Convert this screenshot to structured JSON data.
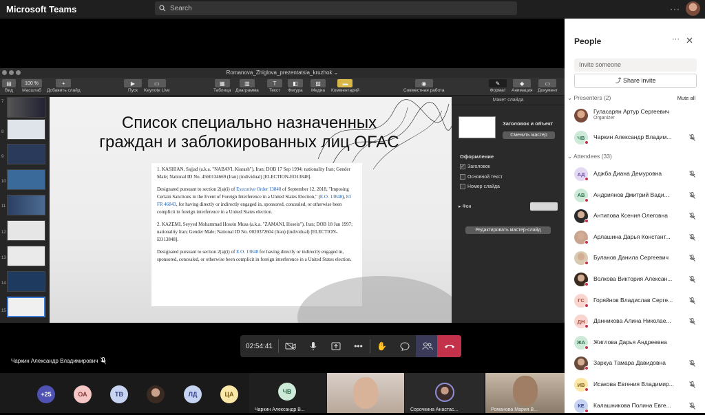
{
  "app": {
    "title": "Microsoft Teams",
    "search_placeholder": "Search",
    "more": "···"
  },
  "keynote": {
    "file_title": "Romanova_Zhiglova_prezentatsia_kruzhok ⌄",
    "zoom": "100 %",
    "toolbar": [
      "Вид",
      "Масштаб",
      "Добавить слайд",
      "Пуск",
      "Keynote Live",
      "Таблица",
      "Диаграмма",
      "Текст",
      "Фигура",
      "Медиа",
      "Комментарий",
      "Совместная работа",
      "Формат",
      "Анимация",
      "Документ"
    ],
    "thumb_numbers": [
      "7",
      "8",
      "9",
      "10",
      "11",
      "12",
      "13",
      "14",
      "15"
    ],
    "slide_title_line1": "Список специально назначенных",
    "slide_title_line2": "граждан и заблокированных лиц OFAC",
    "textbox": {
      "p1": "1. KASHIAN, Sajjad (a.k.a. \"NABAVI, Kiarash\"), Iran; DOB 17 Sep 1994; nationality Iran; Gender Male; National ID No. 4560134669 (Iran) (individual) [ELECTION-EO13848].",
      "p2a": "Designated pursuant to section 2(a)(i) of ",
      "p2link1": "Executive Order 13848",
      "p2b": " of September 12, 2018, \"Imposing Certain Sanctions in the Event of Foreign Interference in a United States Election,\" (",
      "p2link2": "E.O. 13848",
      "p2c": "), ",
      "p2link3": "83 FR 46843",
      "p2d": ", for having directly or indirectly engaged in, sponsored, concealed, or otherwise been complicit in foreign interference in a United States election.",
      "p3": "2. KAZEMI, Seyyed Mohammad Hosein Musa (a.k.a. \"ZAMANI, Hosein\"), Iran; DOB 18 Jun 1997; nationality Iran; Gender Male; National ID No. 0020372604 (Iran) (individual) [ELECTION-EO13848].",
      "p4a": "Designated pursuant to section 2(a)(i) of ",
      "p4link": "E.O. 13848",
      "p4b": " for having directly or indirectly engaged in, sponsored, concealed, or otherwise been complicit in foreign interference in a United States election."
    },
    "inspector": {
      "header": "Макет слайда",
      "layout_name": "Заголовок и объект",
      "change_master": "Сменить мастер",
      "design": "Оформление",
      "chk_title": "Заголовок",
      "chk_body": "Основной текст",
      "chk_number": "Номер слайда",
      "background": "Фон",
      "edit_master": "Редактировать мастер-слайд"
    }
  },
  "call": {
    "timer": "02:54:41",
    "speaker": "Чаркин Александр Владимирович"
  },
  "gallery": [
    {
      "initials": "+25",
      "color": "#4f52b2"
    },
    {
      "initials": "ОА",
      "color": "#f4c6c6"
    },
    {
      "initials": "ТВ",
      "color": "#c7d4f1"
    },
    {
      "initials": "",
      "color": "#5a4a3a"
    },
    {
      "initials": "ЛД",
      "color": "#c7d4f1"
    },
    {
      "initials": "ЦА",
      "color": "#fbe7a8"
    },
    {
      "initials": "ЧВ",
      "color": "#cde9d8",
      "label": "Чаркин Александр В..."
    },
    {
      "label": "Сорочкина Анастас..."
    },
    {
      "label": "Романова Мария В..."
    }
  ],
  "people": {
    "title": "People",
    "invite_placeholder": "Invite someone",
    "share_invite": "Share invite",
    "presenters_label": "Presenters (2)",
    "mute_all": "Mute all",
    "presenters": [
      {
        "name": "Гуласарян Артур Сергеевич",
        "role": "Organizer",
        "initials": "",
        "color": "#b07a5a"
      },
      {
        "name": "Чаркин Александр Владим...",
        "initials": "ЧВ",
        "color": "#cde9d8"
      }
    ],
    "attendees_label": "Attendees (33)",
    "attendees": [
      {
        "name": "Аджба Диана Демуровна",
        "initials": "АД",
        "color": "#e3d9f3"
      },
      {
        "name": "Андриянов Дмитрий Вади...",
        "initials": "АВ",
        "color": "#cde9d8"
      },
      {
        "name": "Антипова Ксения Олеговна",
        "initials": "",
        "color": "#2b2b2b"
      },
      {
        "name": "Арлашина Дарья Констант...",
        "initials": "",
        "color": "#c9a48e"
      },
      {
        "name": "Буланов Данила Сергеевич",
        "initials": "",
        "color": "#d9c9b0"
      },
      {
        "name": "Волкова Виктория Алексан...",
        "initials": "",
        "color": "#3a2a20"
      },
      {
        "name": "Горяйнов Владислав Серге...",
        "initials": "ГС",
        "color": "#f8d6cf"
      },
      {
        "name": "Данникова Алина Николае...",
        "initials": "ДН",
        "color": "#f8d6cf"
      },
      {
        "name": "Жиглова Дарья Андреевна",
        "initials": "ЖА",
        "color": "#cde9d8"
      },
      {
        "name": "Заркуа Тамара Давидовна",
        "initials": "",
        "color": "#6a4a3a"
      },
      {
        "name": "Исакова Евгения Владимир...",
        "initials": "ИВ",
        "color": "#fbe7a8"
      },
      {
        "name": "Калашникова Полина Евге...",
        "initials": "КЕ",
        "color": "#c7d4f1"
      }
    ]
  }
}
